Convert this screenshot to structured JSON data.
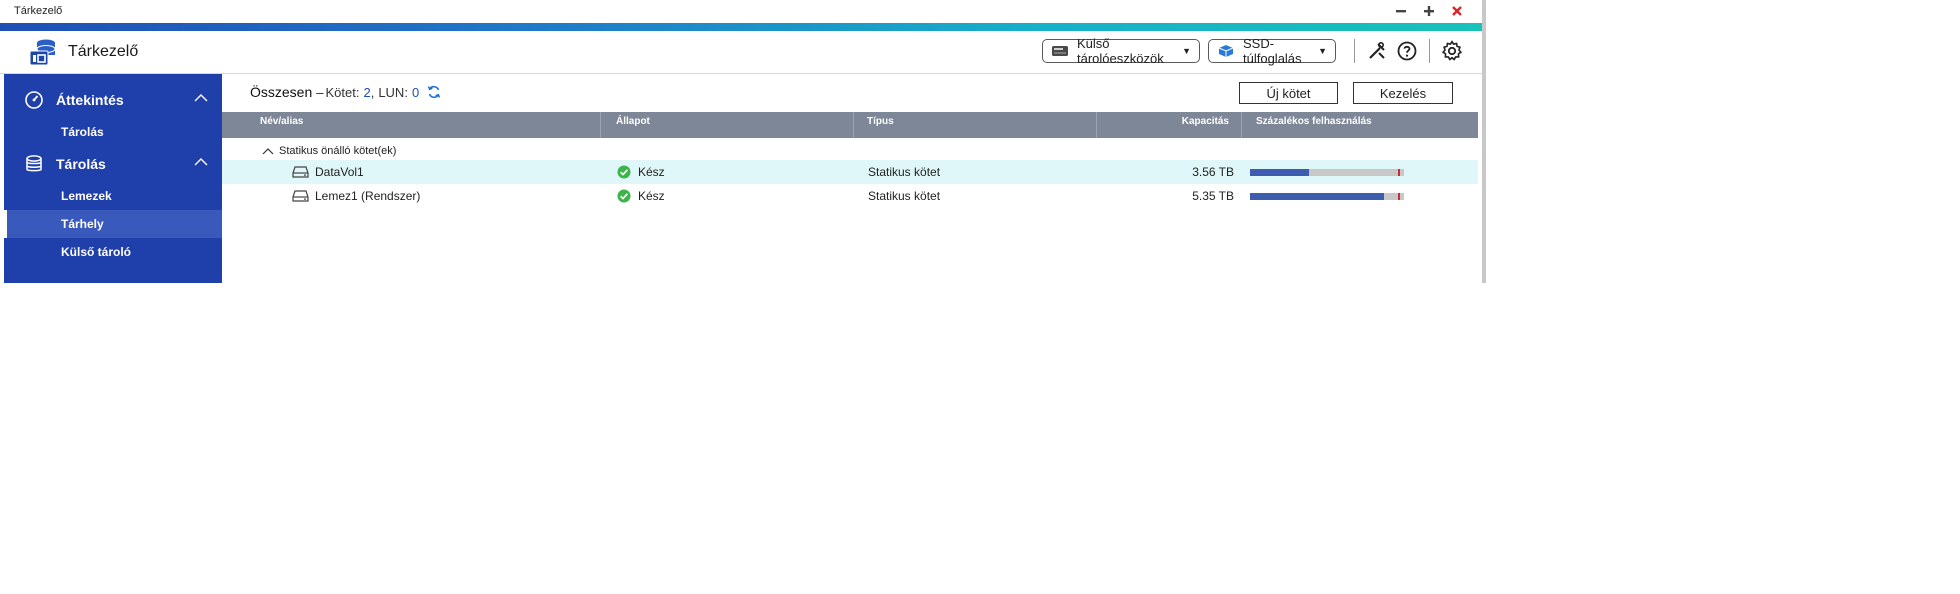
{
  "window": {
    "title": "Tárkezelő"
  },
  "app": {
    "name": "Tárkezelő"
  },
  "header": {
    "external_devices_label": "Külső tárolóeszközök",
    "ssd_overprovisioning_label": "SSD-túlfoglalás"
  },
  "sidebar": {
    "groups": [
      {
        "label": "Áttekintés",
        "items": [
          {
            "label": "Tárolás"
          }
        ]
      },
      {
        "label": "Tárolás",
        "items": [
          {
            "label": "Lemezek"
          },
          {
            "label": "Tárhely"
          },
          {
            "label": "Külső tároló"
          }
        ]
      }
    ]
  },
  "summary": {
    "total_label": "Összesen",
    "volume_label": "Kötet:",
    "volume_count": "2",
    "lun_label": "LUN:",
    "lun_count": "0"
  },
  "actions": {
    "new_volume": "Új kötet",
    "manage": "Kezelés"
  },
  "table": {
    "columns": {
      "name": "Név/alias",
      "status": "Állapot",
      "type": "Típus",
      "capacity": "Kapacitás",
      "usage": "Százalékos felhasználás"
    },
    "group_label": "Statikus önálló kötet(ek)",
    "rows": [
      {
        "name": "DataVol1",
        "status": "Kész",
        "type": "Statikus kötet",
        "capacity": "3.56 TB",
        "usage_fraction": 0.38,
        "threshold_fraction": 0.96
      },
      {
        "name": "Lemez1 (Rendszer)",
        "status": "Kész",
        "type": "Statikus kötet",
        "capacity": "5.35 TB",
        "usage_fraction": 0.87,
        "threshold_fraction": 0.96
      }
    ]
  },
  "colors": {
    "sidebar_bg": "#1f3faa",
    "accent": "#1f4fb5",
    "status_ok": "#3bb54a",
    "usage_bar": "#3c5db0",
    "usage_threshold": "#d02a2a"
  }
}
